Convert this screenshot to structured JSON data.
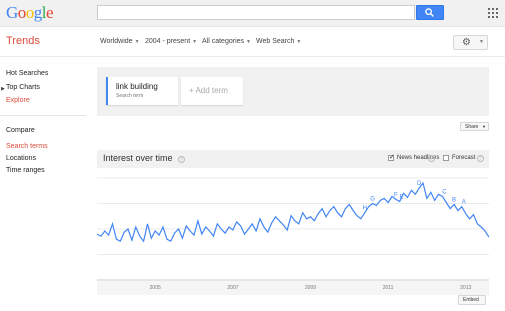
{
  "header": {
    "logo_letters": [
      "G",
      "o",
      "o",
      "g",
      "l",
      "e"
    ],
    "logo_colors": [
      "#4285f4",
      "#ea4335",
      "#fbbc05",
      "#4285f4",
      "#34a853",
      "#ea4335"
    ],
    "search_value": "",
    "search_icon": "search-icon",
    "apps_icon": "apps-grid-icon"
  },
  "subheader": {
    "title": "Trends",
    "filters": [
      "Worldwide",
      "2004 - present",
      "All categories",
      "Web Search"
    ],
    "settings_icon": "gear-icon"
  },
  "nav": {
    "items": [
      "Hot Searches",
      "Top Charts",
      "Explore"
    ],
    "section_title": "Compare",
    "compare_items": [
      "Search terms",
      "Locations",
      "Time ranges"
    ],
    "accent_color": "#dd4b39"
  },
  "terms": {
    "term": "link building",
    "term_type": "Search term",
    "add_label": "+ Add term"
  },
  "share_label": "Share",
  "chart_header": {
    "title": "Interest over time",
    "news_headlines_label": "News headlines",
    "news_headlines_checked": true,
    "forecast_label": "Forecast",
    "forecast_checked": false
  },
  "embed_label": "Embed",
  "chart_data": {
    "type": "line",
    "title": "",
    "xlabel": "",
    "ylabel": "",
    "x_ticks": [
      "2005",
      "2007",
      "2009",
      "2011",
      "2013"
    ],
    "x_range": [
      2004.0,
      2014.1
    ],
    "ylim": [
      0,
      100
    ],
    "grid": true,
    "line_color": "#4285f4",
    "series": [
      {
        "x": [
          2004.0,
          2004.1,
          2004.2,
          2004.3,
          2004.4,
          2004.5,
          2004.6,
          2004.7,
          2004.8,
          2004.9,
          2005.0,
          2005.1,
          2005.2,
          2005.3,
          2005.4,
          2005.5,
          2005.6,
          2005.7,
          2005.8,
          2005.9,
          2006.0,
          2006.1,
          2006.2,
          2006.3,
          2006.4,
          2006.5,
          2006.6,
          2006.7,
          2006.8,
          2006.9,
          2007.0,
          2007.1,
          2007.2,
          2007.3,
          2007.4,
          2007.5,
          2007.6,
          2007.7,
          2007.8,
          2007.9,
          2008.0,
          2008.1,
          2008.2,
          2008.3,
          2008.4,
          2008.5,
          2008.6,
          2008.7,
          2008.8,
          2008.9,
          2009.0,
          2009.1,
          2009.2,
          2009.3,
          2009.4,
          2009.5,
          2009.6,
          2009.7,
          2009.8,
          2009.9,
          2010.0,
          2010.1,
          2010.2,
          2010.3,
          2010.4,
          2010.5,
          2010.6,
          2010.7,
          2010.8,
          2010.9,
          2011.0,
          2011.1,
          2011.2,
          2011.3,
          2011.4,
          2011.5,
          2011.6,
          2011.7,
          2011.8,
          2011.9,
          2012.0,
          2012.1,
          2012.2,
          2012.3,
          2012.4,
          2012.5,
          2012.6,
          2012.7,
          2012.8,
          2012.9,
          2013.0,
          2013.1,
          2013.2,
          2013.3,
          2013.4,
          2013.5,
          2013.6,
          2013.7,
          2013.8,
          2013.9,
          2014.0,
          2014.1
        ],
        "y": [
          45,
          43,
          48,
          44,
          55,
          40,
          38,
          47,
          50,
          39,
          52,
          43,
          38,
          55,
          41,
          48,
          44,
          52,
          40,
          38,
          46,
          50,
          41,
          53,
          48,
          44,
          58,
          45,
          52,
          48,
          43,
          55,
          50,
          46,
          52,
          49,
          57,
          53,
          45,
          50,
          55,
          48,
          60,
          52,
          47,
          56,
          62,
          58,
          54,
          49,
          63,
          58,
          55,
          66,
          60,
          62,
          58,
          65,
          70,
          62,
          68,
          72,
          66,
          62,
          70,
          74,
          68,
          63,
          60,
          66,
          72,
          75,
          73,
          78,
          80,
          76,
          82,
          79,
          77,
          85,
          81,
          88,
          84,
          90,
          95,
          80,
          86,
          78,
          84,
          82,
          76,
          70,
          74,
          68,
          72,
          65,
          60,
          64,
          55,
          52,
          48,
          42
        ]
      }
    ],
    "annotations": [
      {
        "label": "H",
        "x": 2010.9
      },
      {
        "label": "G",
        "x": 2011.1
      },
      {
        "label": "F",
        "x": 2011.7
      },
      {
        "label": "E",
        "x": 2011.85
      },
      {
        "label": "D",
        "x": 2012.3
      },
      {
        "label": "C",
        "x": 2012.95
      },
      {
        "label": "B",
        "x": 2013.2
      },
      {
        "label": "A",
        "x": 2013.45
      }
    ]
  }
}
